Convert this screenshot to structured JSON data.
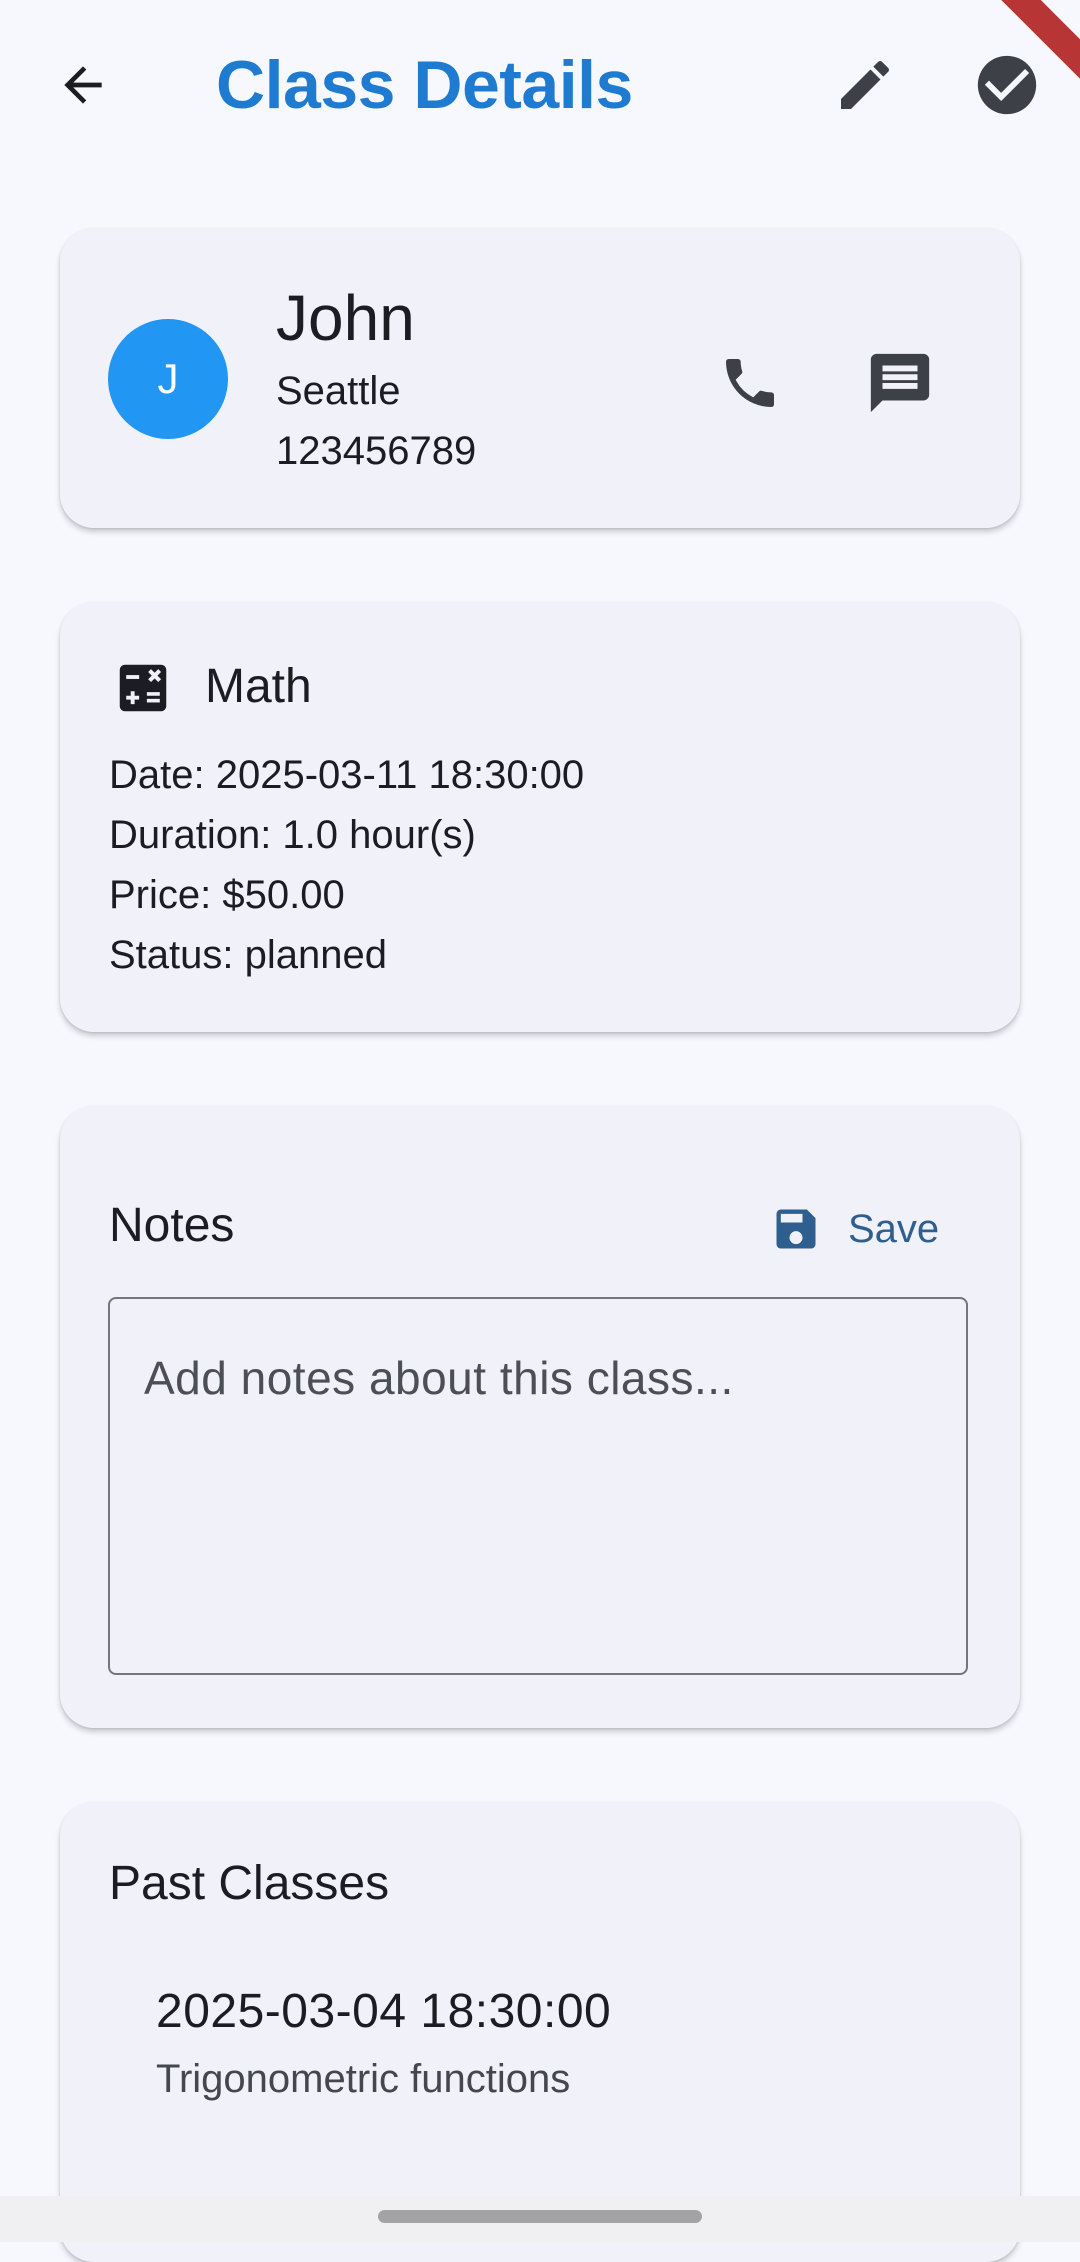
{
  "app_bar": {
    "title": "Class Details",
    "back_icon": "arrow-back-icon",
    "edit_icon": "edit-pencil-icon",
    "done_icon": "check-circle-icon",
    "title_color": "#1e7bd0"
  },
  "contact": {
    "avatar_initial": "J",
    "avatar_color": "#2196f3",
    "name": "John",
    "city": "Seattle",
    "phone": "123456789",
    "call_icon": "phone-icon",
    "message_icon": "message-icon"
  },
  "class_info": {
    "subject_icon": "calculate-icon",
    "subject": "Math",
    "date_line": "Date: 2025-03-11 18:30:00",
    "duration_line": "Duration: 1.0 hour(s)",
    "price_line": "Price: $50.00",
    "status_line": "Status: planned"
  },
  "notes": {
    "title": "Notes",
    "save_label": "Save",
    "save_icon": "save-icon",
    "placeholder": "Add notes about this class...",
    "value": ""
  },
  "past_classes": {
    "title": "Past Classes",
    "items": [
      {
        "date": "2025-03-04 18:30:00",
        "topic": "Trigonometric functions"
      }
    ]
  }
}
